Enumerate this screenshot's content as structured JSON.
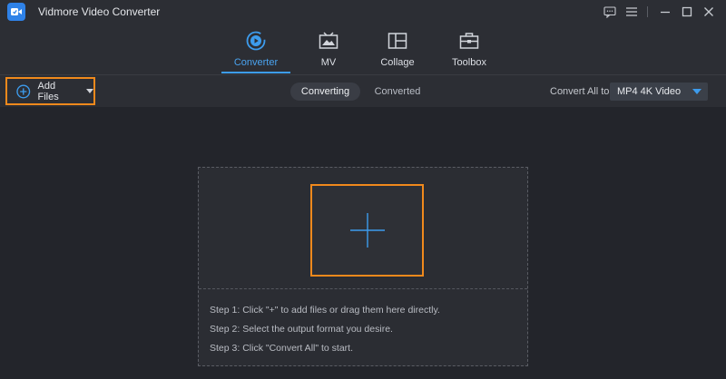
{
  "window": {
    "title": "Vidmore Video Converter",
    "controls": [
      "feedback-icon",
      "menu-icon",
      "minimize-icon",
      "maximize-icon",
      "close-icon"
    ]
  },
  "nav": {
    "tabs": [
      {
        "label": "Converter",
        "icon": "converter-icon",
        "active": true
      },
      {
        "label": "MV",
        "icon": "mv-icon",
        "active": false
      },
      {
        "label": "Collage",
        "icon": "collage-icon",
        "active": false
      },
      {
        "label": "Toolbox",
        "icon": "toolbox-icon",
        "active": false
      }
    ]
  },
  "toolbar": {
    "add_files_label": "Add Files",
    "segments": {
      "converting": "Converting",
      "converted": "Converted"
    },
    "convert_all_label": "Convert All to:",
    "format_value": "MP4 4K Video"
  },
  "dropzone": {
    "steps": [
      "Step 1: Click \"+\" to add files or drag them here directly.",
      "Step 2: Select the output format you desire.",
      "Step 3: Click \"Convert All\" to start."
    ]
  },
  "colors": {
    "accent": "#3d9ced",
    "highlight": "#f0891c",
    "background": "#23252b",
    "panel": "#2c2e34"
  }
}
